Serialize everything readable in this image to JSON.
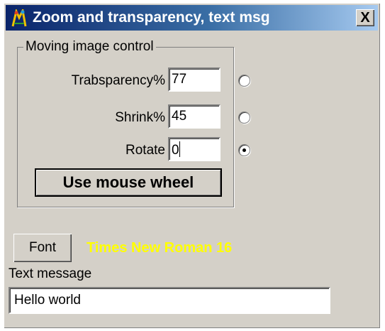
{
  "window": {
    "title": "Zoom and transparency, text msg",
    "close_label": "X"
  },
  "icons": {
    "app": "app-icon",
    "close": "close-icon"
  },
  "group": {
    "title": "Moving image control",
    "rows": [
      {
        "label": "Trabsparency%",
        "value": "77",
        "selected": false
      },
      {
        "label": "Shrink%",
        "value": "45",
        "selected": false
      },
      {
        "label": "Rotate",
        "value": "0",
        "selected": true
      }
    ],
    "mouse_wheel_label": "Use mouse wheel"
  },
  "font": {
    "button_label": "Font",
    "current": "Times New Roman  16",
    "current_color": "#ffff00"
  },
  "text_message": {
    "label": "Text message",
    "value": "Hello world"
  }
}
